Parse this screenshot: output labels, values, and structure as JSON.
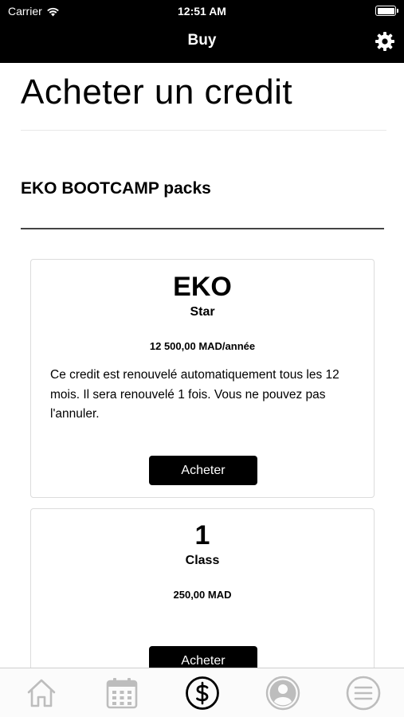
{
  "status_bar": {
    "carrier": "Carrier",
    "time": "12:51 AM"
  },
  "nav": {
    "title": "Buy",
    "settings_icon": "gear-icon"
  },
  "page": {
    "title": "Acheter un credit",
    "section_title": "EKO BOOTCAMP packs"
  },
  "packs": [
    {
      "name": "EKO",
      "subtitle": "Star",
      "price": "12 500,00 MAD/année",
      "description": "Ce credit est renouvelé automatiquement tous les 12 mois. Il sera renouvelé 1 fois. Vous ne pouvez pas l'annuler.",
      "button_label": "Acheter"
    },
    {
      "name": "1",
      "subtitle": "Class",
      "price": "250,00 MAD",
      "button_label": "Acheter"
    }
  ],
  "tab_bar": {
    "tabs": [
      {
        "icon": "home-icon",
        "active": false
      },
      {
        "icon": "calendar-icon",
        "active": false
      },
      {
        "icon": "dollar-icon",
        "active": true
      },
      {
        "icon": "profile-icon",
        "active": false
      },
      {
        "icon": "menu-icon",
        "active": false
      }
    ]
  },
  "colors": {
    "bar_bg": "#000000",
    "accent": "#000000",
    "inactive_icon": "#bdbdbd"
  }
}
